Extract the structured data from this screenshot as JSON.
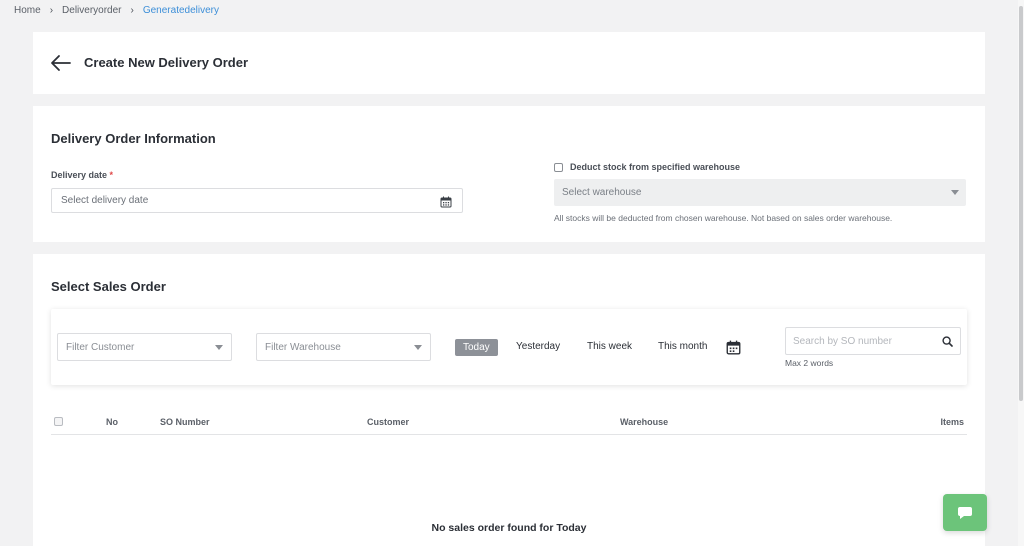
{
  "breadcrumb": {
    "items": [
      "Home",
      "Deliveryorder",
      "Generatedelivery"
    ],
    "separator": ">"
  },
  "header": {
    "back_icon": "arrow-left-icon",
    "title": "Create New Delivery Order"
  },
  "info": {
    "section_title": "Delivery Order Information",
    "delivery_date_label": "Delivery date",
    "required_mark": "*",
    "delivery_date_placeholder": "Select delivery date",
    "calendar_icon": "calendar-icon",
    "deduct_checkbox_label": "Deduct stock from specified warehouse",
    "deduct_checked": false,
    "warehouse_placeholder": "Select warehouse",
    "warehouse_hint": "All stocks will be deducted from chosen warehouse. Not based on sales order warehouse."
  },
  "orders": {
    "section_title": "Select Sales Order",
    "filter_customer": "Filter Customer",
    "filter_warehouse": "Filter Warehouse",
    "ranges": [
      "Today",
      "Yesterday",
      "This week",
      "This month"
    ],
    "active_range": "Today",
    "search_placeholder": "Search by SO number",
    "search_hint": "Max 2 words",
    "columns": [
      "No",
      "SO Number",
      "Customer",
      "Warehouse",
      "Items"
    ],
    "empty_message": "No sales order found for Today"
  },
  "colors": {
    "accent_link": "#3d8fd8",
    "active_pill": "#8d9198",
    "chat_button": "#6cc47a",
    "required": "#e04848"
  },
  "chat_icon": "chat-bubble-icon"
}
